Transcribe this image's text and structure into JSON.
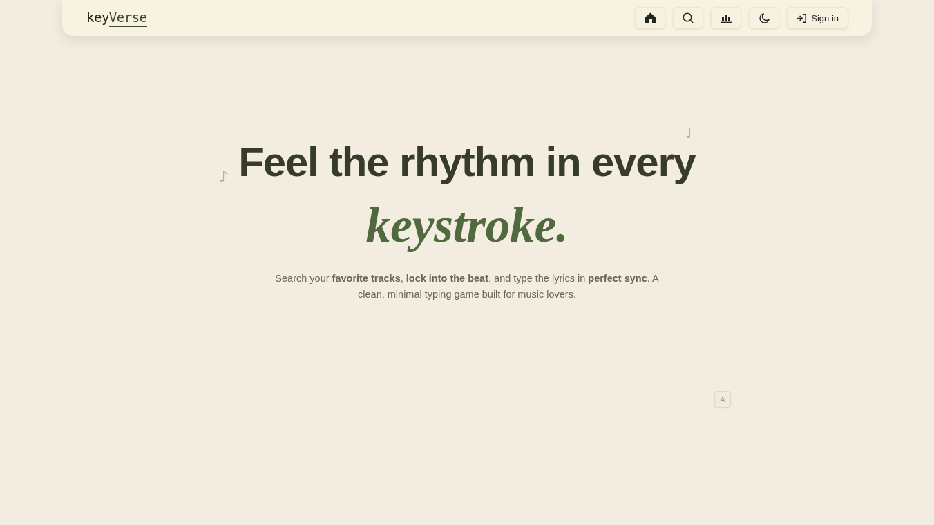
{
  "header": {
    "logo": {
      "prefix": "key",
      "accent": "Verse"
    },
    "nav": [
      {
        "kind": "home"
      },
      {
        "kind": "search"
      },
      {
        "kind": "chart"
      },
      {
        "kind": "theme"
      }
    ],
    "sign_in": {
      "label": "Sign in"
    }
  },
  "hero": {
    "headline": "Feel the rhythm in every",
    "accent": "keystroke.",
    "subtitle": "Search your **favorite tracks**, **lock into the beat**, and type the lyrics in **perfect sync**. A clean, minimal typing game built for music lovers."
  },
  "decorations": [
    {
      "kind": "note",
      "text": "♪"
    },
    {
      "kind": "note",
      "text": "♩"
    },
    {
      "kind": "key",
      "text": "A"
    }
  ]
}
